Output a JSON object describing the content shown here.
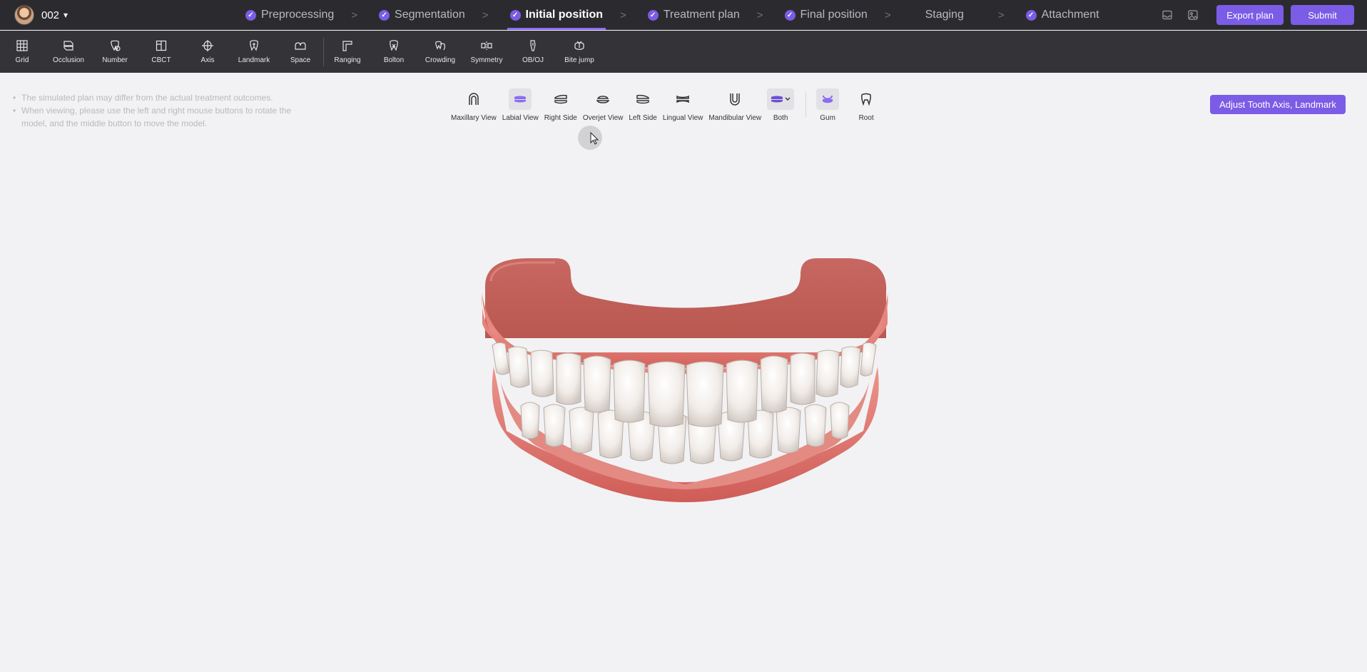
{
  "patient": {
    "id": "002"
  },
  "steps": [
    {
      "label": "Preprocessing"
    },
    {
      "label": "Segmentation"
    },
    {
      "label": "Initial position"
    },
    {
      "label": "Treatment plan"
    },
    {
      "label": "Final position"
    },
    {
      "label": "Staging"
    },
    {
      "label": "Attachment"
    }
  ],
  "actions": {
    "export_label": "Export plan",
    "submit_label": "Submit"
  },
  "tools": [
    {
      "label": "Grid",
      "icon": "grid-icon"
    },
    {
      "label": "Occlusion",
      "icon": "occlusion-icon"
    },
    {
      "label": "Number",
      "icon": "number-icon"
    },
    {
      "label": "CBCT",
      "icon": "cbct-icon"
    },
    {
      "label": "Axis",
      "icon": "axis-icon"
    },
    {
      "label": "Landmark",
      "icon": "landmark-icon"
    },
    {
      "label": "Space",
      "icon": "space-icon"
    },
    {
      "label": "Ranging",
      "icon": "ranging-icon"
    },
    {
      "label": "Bolton",
      "icon": "bolton-icon"
    },
    {
      "label": "Crowding",
      "icon": "crowding-icon"
    },
    {
      "label": "Symmetry",
      "icon": "symmetry-icon"
    },
    {
      "label": "OB/OJ",
      "icon": "obj-icon"
    },
    {
      "label": "Bite jump",
      "icon": "bite-jump-icon"
    }
  ],
  "notes": [
    "The simulated plan may differ from the actual treatment outcomes.",
    "When viewing, please use the left and right mouse buttons to rotate the model, and the middle button to move the model."
  ],
  "views": [
    {
      "label": "Maxillary View"
    },
    {
      "label": "Labial View"
    },
    {
      "label": "Right Side"
    },
    {
      "label": "Overjet View"
    },
    {
      "label": "Left Side"
    },
    {
      "label": "Lingual View"
    },
    {
      "label": "Mandibular View"
    },
    {
      "label": "Both"
    }
  ],
  "toggles": [
    {
      "label": "Gum"
    },
    {
      "label": "Root"
    }
  ],
  "adjust_label": "Adjust Tooth Axis, Landmark",
  "colors": {
    "accent": "#7b5ce6",
    "topbar": "#2b2b2f",
    "toolbar": "#333338",
    "gum": "#e0736e"
  }
}
